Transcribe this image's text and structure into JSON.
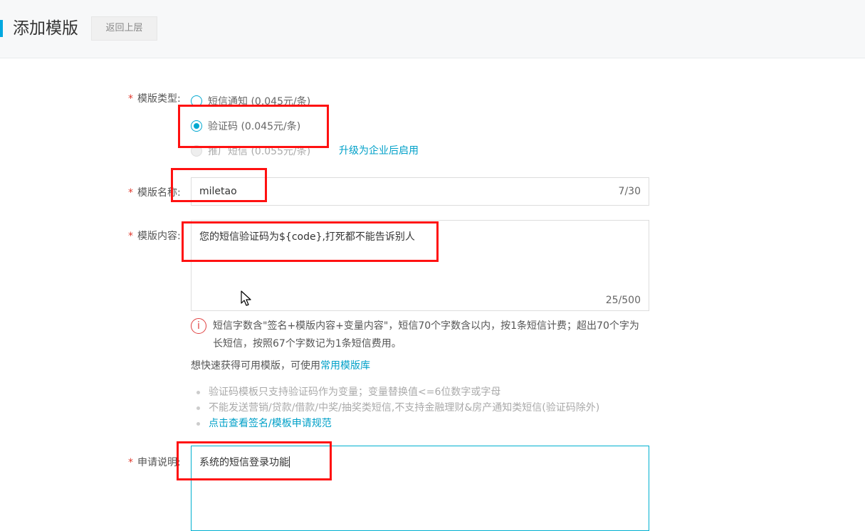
{
  "header": {
    "title": "添加模版",
    "back_label": "返回上层"
  },
  "form": {
    "type": {
      "label": "模版类型:",
      "options": [
        {
          "label": "短信通知 (0.045元/条)",
          "state": "unchecked"
        },
        {
          "label": "验证码 (0.045元/条)",
          "state": "checked"
        },
        {
          "label": "推广短信 (0.055元/条)",
          "state": "disabled"
        }
      ],
      "upgrade_link": "升级为企业后启用"
    },
    "name": {
      "label": "模版名称:",
      "value": "miletao",
      "count": "7/30"
    },
    "content": {
      "label": "模版内容:",
      "value": "您的短信验证码为${code},打死都不能告诉别人",
      "count": "25/500",
      "info_icon": "i",
      "info": "短信字数含\"签名+模版内容+变量内容\"，短信70个字数含以内，按1条短信计费；超出70个字为长短信，按照67个字数记为1条短信费用。",
      "quick_prefix": "想快速获得可用模版，可使用",
      "quick_link": "常用模版库",
      "tips": [
        "验证码模板只支持验证码作为变量；变量替换值<=6位数字或字母",
        "不能发送营销/贷款/借款/中奖/抽奖类短信,不支持金融理财&房产通知类短信(验证码除外)",
        "点击查看签名/模板申请规范"
      ]
    },
    "apply": {
      "label": "申请说明:",
      "value": "系统的短信登录功能"
    }
  },
  "colors": {
    "accent": "#00a8e0",
    "link": "#00a0c8",
    "required": "#e03a2e",
    "annotation": "#ff1111"
  },
  "icons": {
    "info": "info-circle-icon",
    "cursor": "mouse-pointer-icon"
  }
}
